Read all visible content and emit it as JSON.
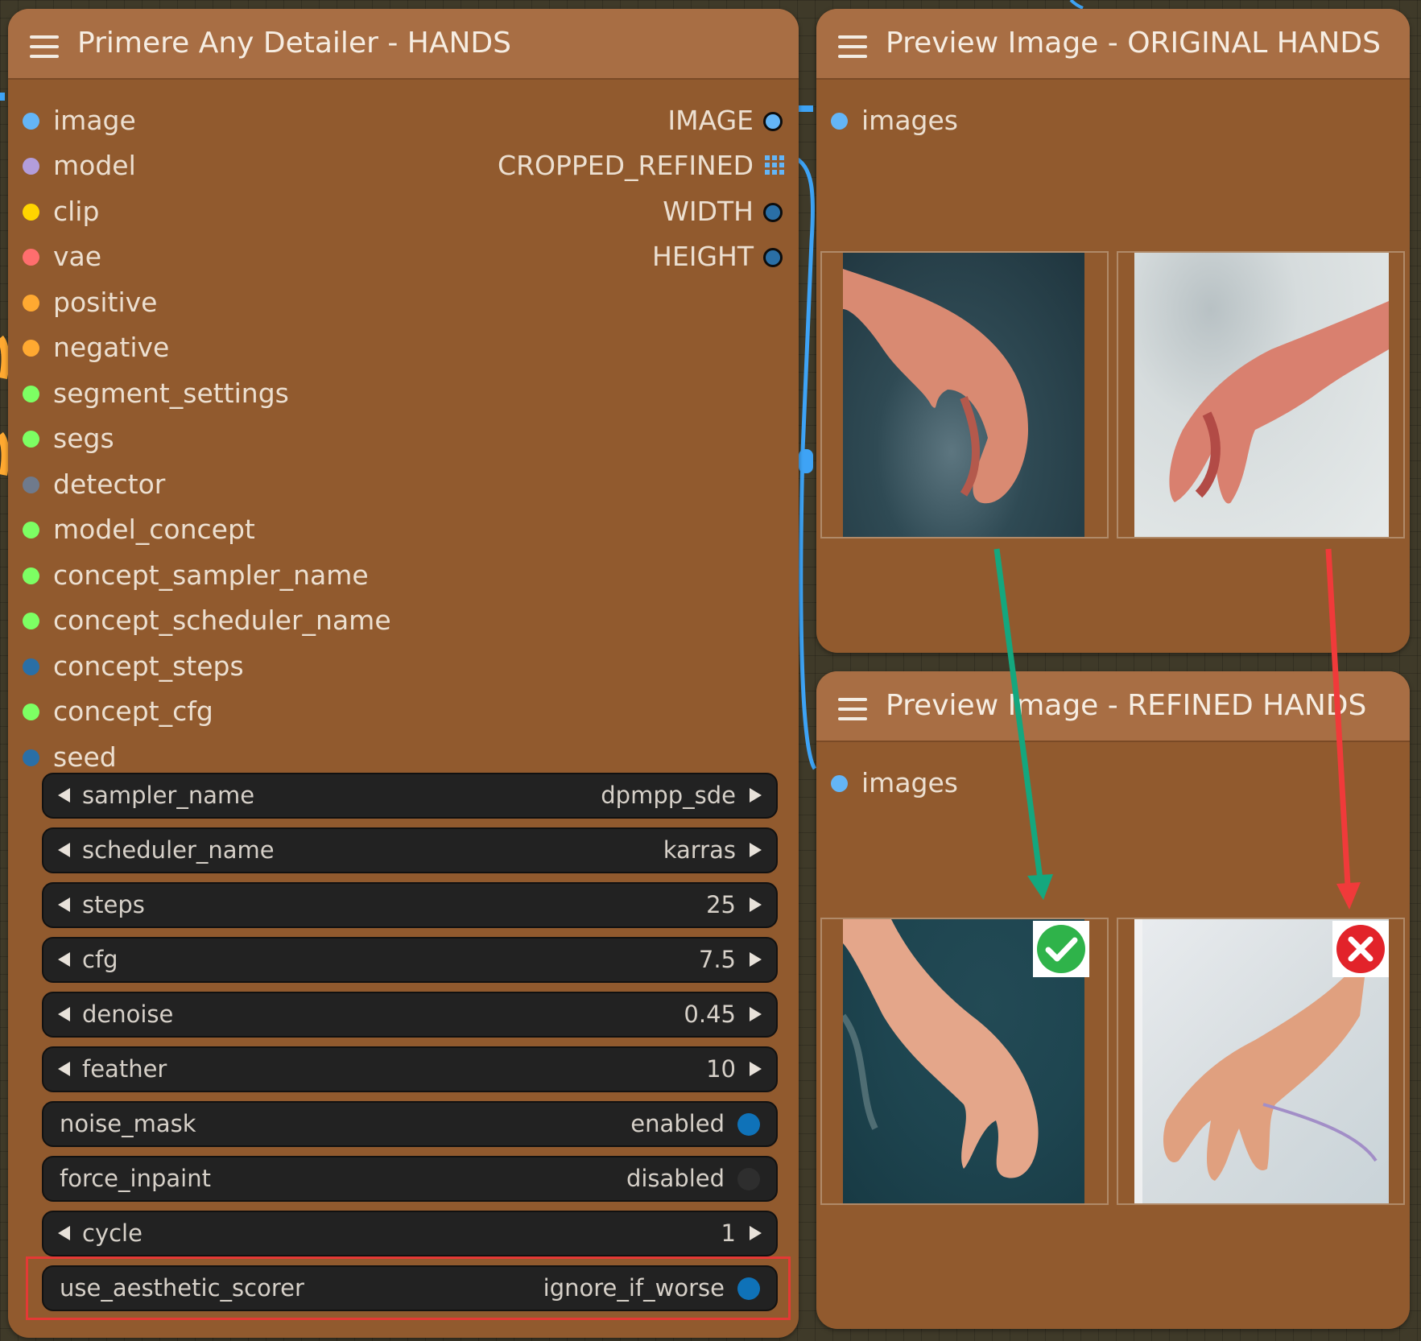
{
  "detailer_node": {
    "title": "Primere Any Detailer - HANDS",
    "inputs": [
      {
        "label": "image",
        "color": "#64b5f6"
      },
      {
        "label": "model",
        "color": "#b39ddb"
      },
      {
        "label": "clip",
        "color": "#ffd500"
      },
      {
        "label": "vae",
        "color": "#ff6e6e"
      },
      {
        "label": "positive",
        "color": "#ffa931"
      },
      {
        "label": "negative",
        "color": "#ffa931"
      },
      {
        "label": "segment_settings",
        "color": "#7dff63"
      },
      {
        "label": "segs",
        "color": "#7dff63"
      },
      {
        "label": "detector",
        "color": "#6f7a8c"
      },
      {
        "label": "model_concept",
        "color": "#7dff63"
      },
      {
        "label": "concept_sampler_name",
        "color": "#7dff63"
      },
      {
        "label": "concept_scheduler_name",
        "color": "#7dff63"
      },
      {
        "label": "concept_steps",
        "color": "#2a6fa6"
      },
      {
        "label": "concept_cfg",
        "color": "#7dff63"
      },
      {
        "label": "seed",
        "color": "#2a6fa6"
      }
    ],
    "outputs": [
      {
        "label": "IMAGE"
      },
      {
        "label": "CROPPED_REFINED"
      },
      {
        "label": "WIDTH"
      },
      {
        "label": "HEIGHT"
      }
    ],
    "widgets": {
      "sampler_name": {
        "label": "sampler_name",
        "value": "dpmpp_sde"
      },
      "scheduler_name": {
        "label": "scheduler_name",
        "value": "karras"
      },
      "steps": {
        "label": "steps",
        "value": "25"
      },
      "cfg": {
        "label": "cfg",
        "value": "7.5"
      },
      "denoise": {
        "label": "denoise",
        "value": "0.45"
      },
      "feather": {
        "label": "feather",
        "value": "10"
      },
      "noise_mask": {
        "label": "noise_mask",
        "value": "enabled"
      },
      "force_inpaint": {
        "label": "force_inpaint",
        "value": "disabled"
      },
      "cycle": {
        "label": "cycle",
        "value": "1"
      },
      "use_aesthetic_scorer": {
        "label": "use_aesthetic_scorer",
        "value": "ignore_if_worse"
      }
    }
  },
  "preview_original": {
    "title": "Preview Image - ORIGINAL HANDS",
    "input_label": "images"
  },
  "preview_refined": {
    "title": "Preview Image - REFINED HANDS",
    "input_label": "images"
  },
  "colors": {
    "node_body": "#915a2e",
    "node_header": "#a86e44",
    "arrow_green": "#14a77e",
    "arrow_red": "#f03a3a",
    "highlight": "#e53935"
  },
  "icons": [
    "menu-icon",
    "check-icon",
    "cross-icon",
    "grid-icon"
  ]
}
